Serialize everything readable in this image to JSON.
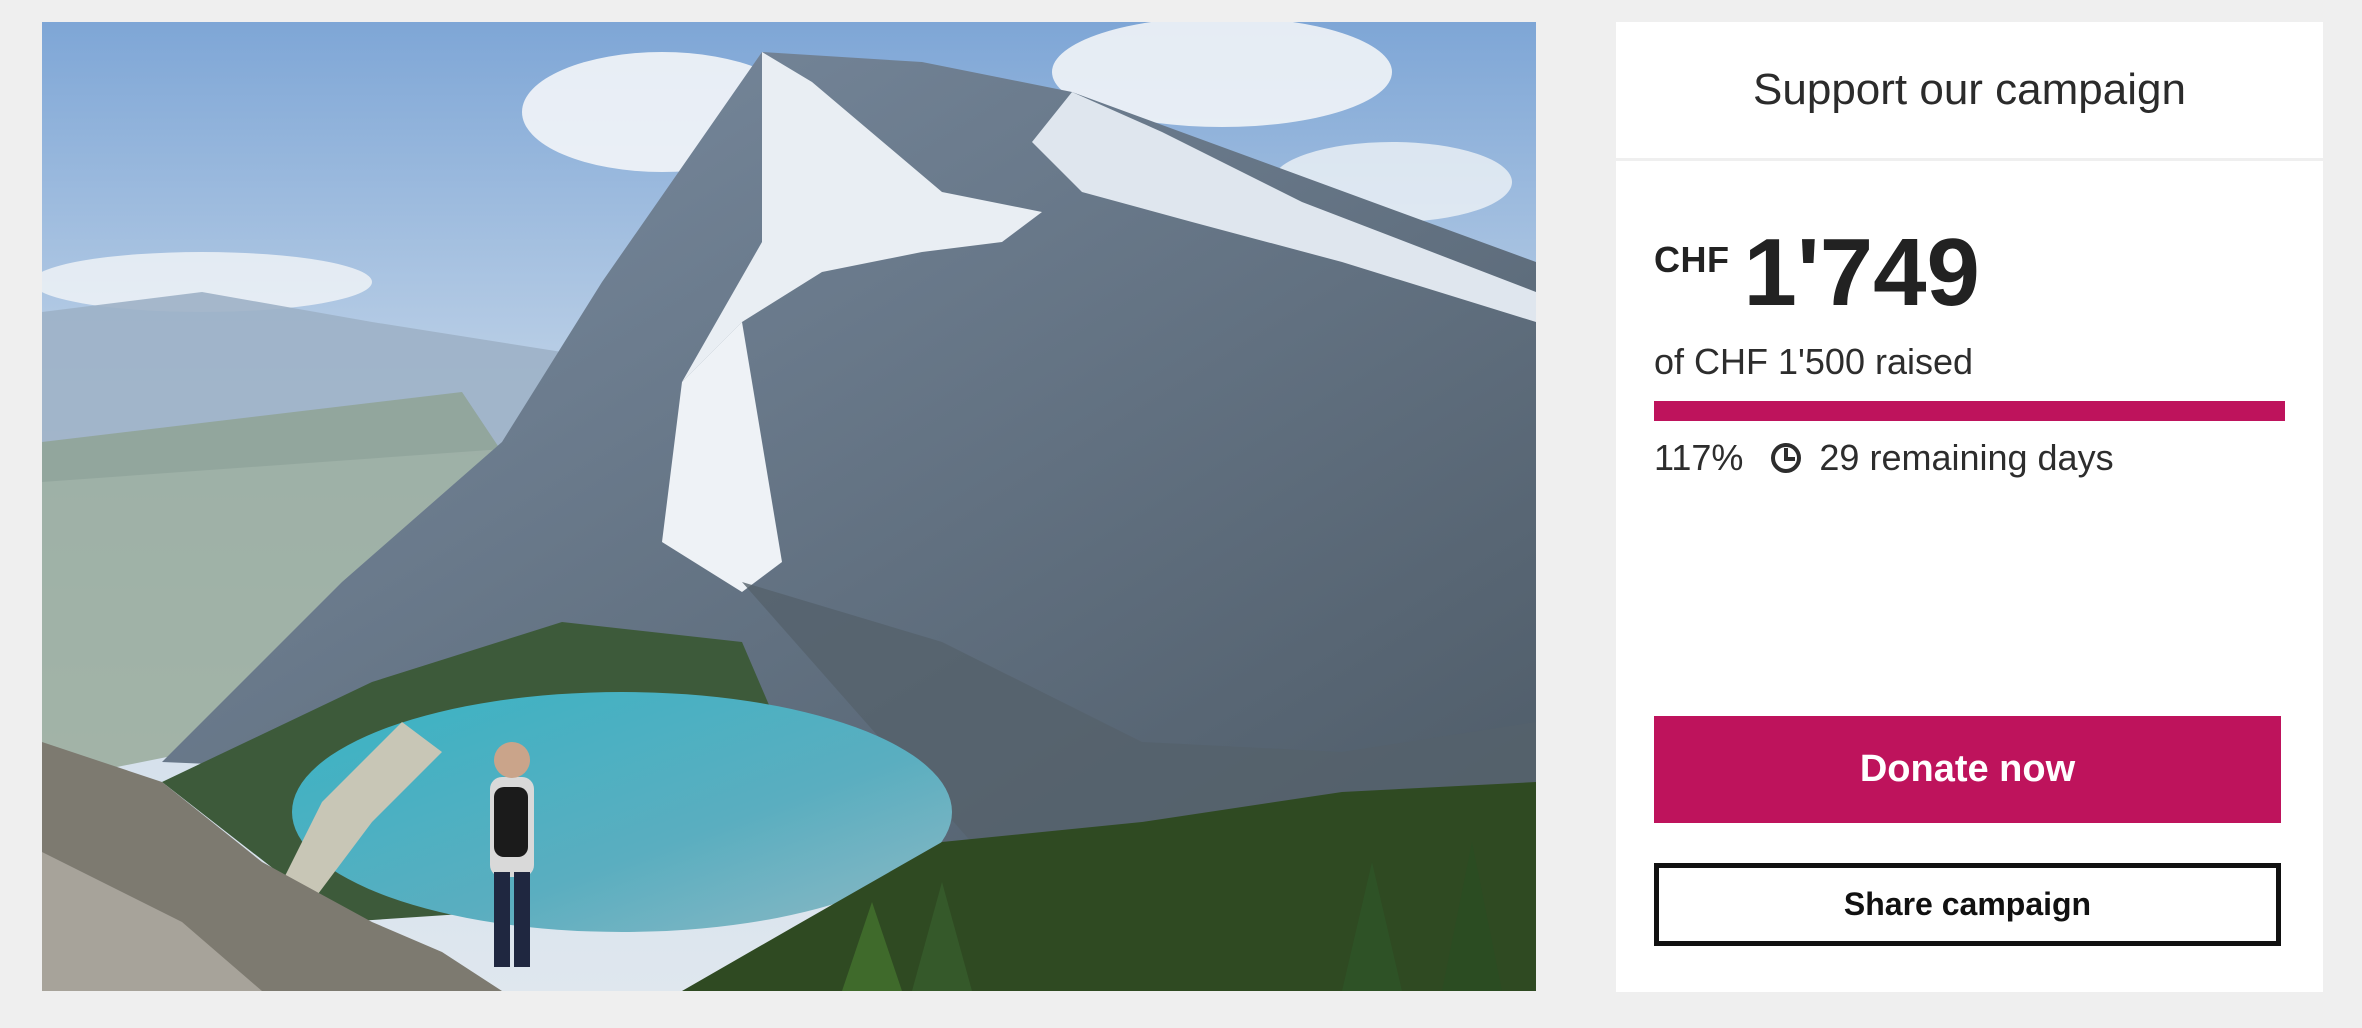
{
  "hero": {
    "image_subject": "hiker overlooking turquoise mountain lake below snowy peak"
  },
  "campaign": {
    "header_title": "Support our campaign",
    "currency": "CHF",
    "amount_raised": "1'749",
    "goal_text": "of CHF 1'500 raised",
    "progress_fraction": 1.0,
    "percent": "117%",
    "remaining": "29 remaining days",
    "donate_label": "Donate now",
    "share_label": "Share campaign"
  },
  "colors": {
    "accent": "#be135c",
    "background": "#efefef",
    "text": "#222222"
  },
  "icons": {
    "clock": "clock-icon"
  }
}
